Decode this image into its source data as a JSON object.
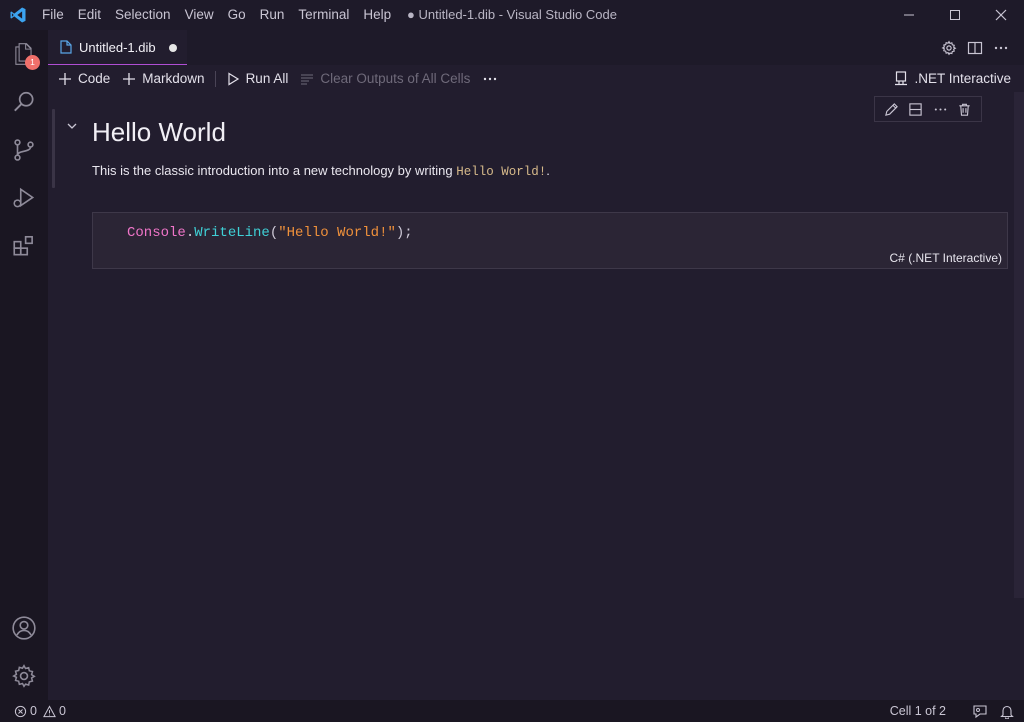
{
  "window": {
    "title": "● Untitled-1.dib - Visual Studio Code",
    "menu": [
      "File",
      "Edit",
      "Selection",
      "View",
      "Go",
      "Run",
      "Terminal",
      "Help"
    ]
  },
  "activity": {
    "explorer_badge": "1",
    "icons": [
      "files-icon",
      "search-icon",
      "source-control-icon",
      "run-debug-icon",
      "extensions-icon",
      "account-icon",
      "gear-icon"
    ]
  },
  "tab": {
    "label": "Untitled-1.dib"
  },
  "notebook_toolbar": {
    "add_code": "Code",
    "add_markdown": "Markdown",
    "run_all": "Run All",
    "clear_outputs": "Clear Outputs of All Cells",
    "more": "···",
    "kernel": ".NET Interactive"
  },
  "cells": {
    "markdown": {
      "title": "Hello World",
      "para_text": "This is the classic introduction into a new technology by writing ",
      "para_code": "Hello World!",
      "para_end": "."
    },
    "code": {
      "tok1": "Console",
      "tok2": ".",
      "tok3": "WriteLine",
      "tok4": "(",
      "tok5": "\"Hello World!\"",
      "tok6": ");",
      "language": "C# (.NET Interactive)"
    }
  },
  "status": {
    "errors": "0",
    "warnings": "0",
    "cell_position": "Cell 1 of 2"
  },
  "colors": {
    "accent": "#b04ed4",
    "badge": "#f1706b",
    "background": "#221d2e"
  }
}
